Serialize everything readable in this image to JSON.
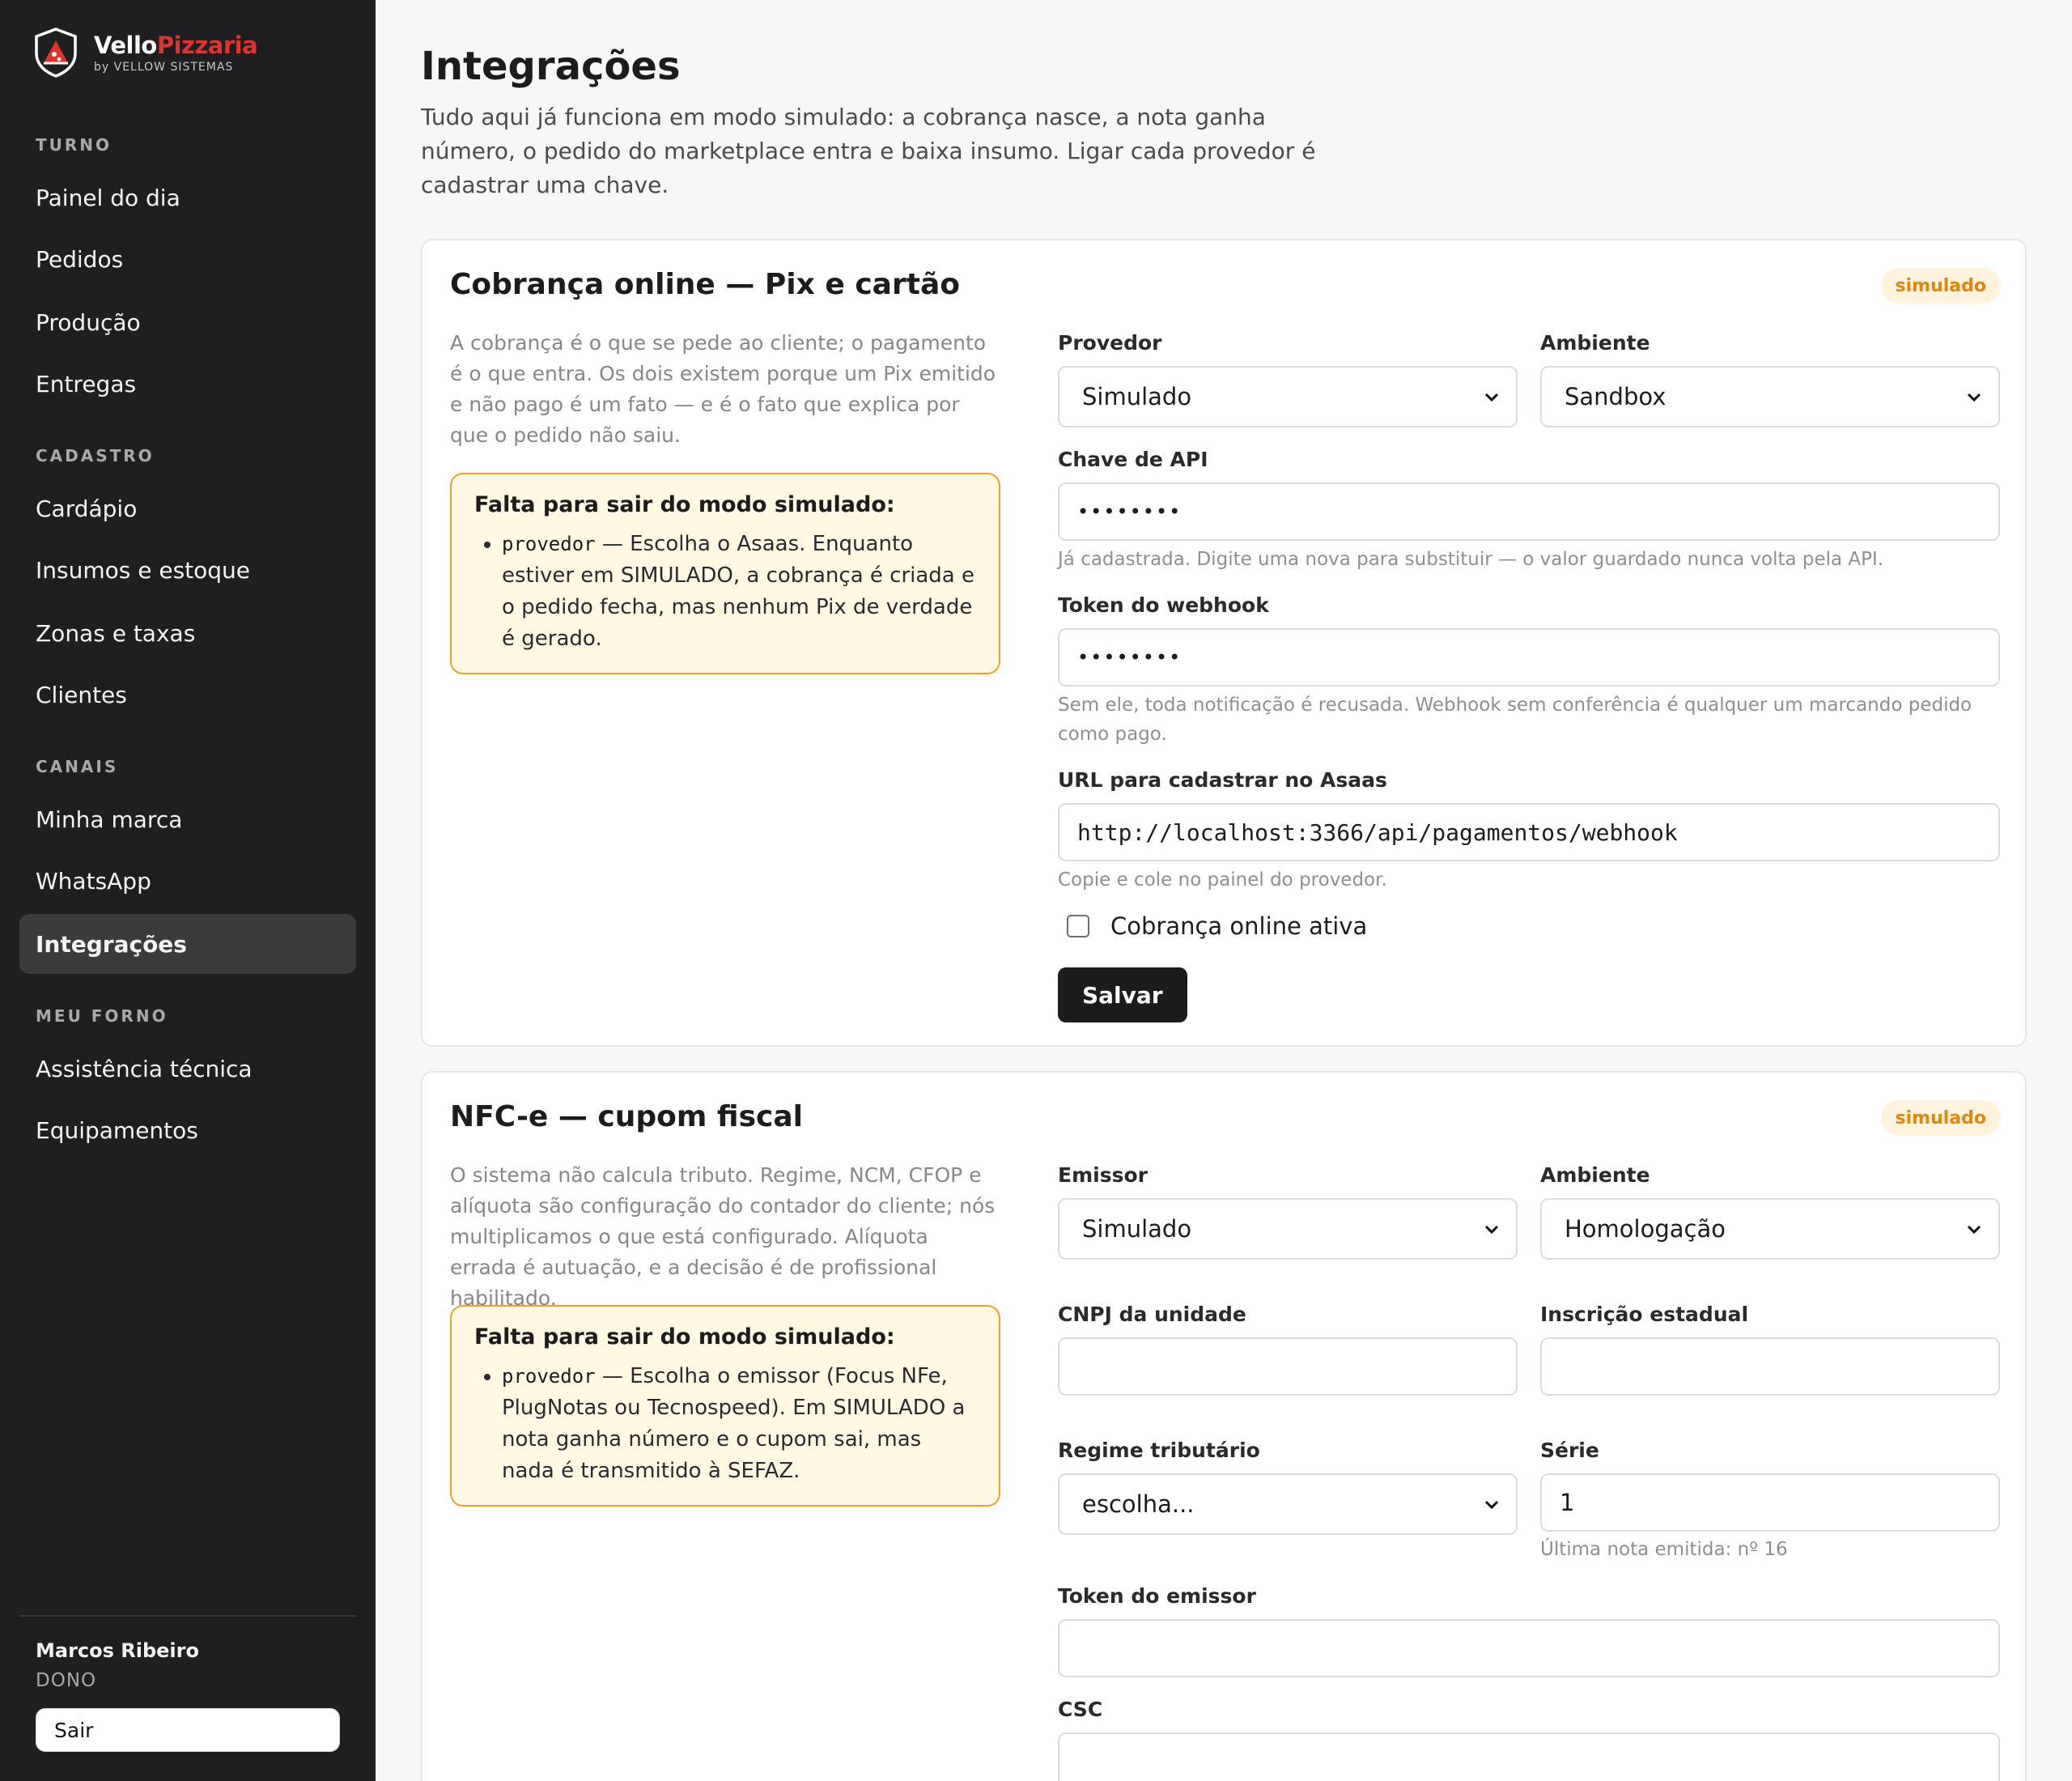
{
  "brand": {
    "name_part1": "Vello",
    "name_part2": "Pizzaria",
    "subtitle": "by VELLOW SISTEMAS",
    "accent_color": "#e2332b",
    "icon": "pizza-shield-icon"
  },
  "sidebar": {
    "sections": [
      {
        "label": "TURNO",
        "items": [
          "Painel do dia",
          "Pedidos",
          "Produção",
          "Entregas"
        ]
      },
      {
        "label": "CADASTRO",
        "items": [
          "Cardápio",
          "Insumos e estoque",
          "Zonas e taxas",
          "Clientes"
        ]
      },
      {
        "label": "CANAIS",
        "items": [
          "Minha marca",
          "WhatsApp",
          "Integrações"
        ]
      },
      {
        "label": "MEU FORNO",
        "items": [
          "Assistência técnica",
          "Equipamentos"
        ]
      }
    ],
    "active_item": "Integrações",
    "user": {
      "name": "Marcos Ribeiro",
      "role": "DONO"
    },
    "logout_label": "Sair"
  },
  "page": {
    "title": "Integrações",
    "description": "Tudo aqui já funciona em modo simulado: a cobrança nasce, a nota ganha número, o pedido do marketplace entra e baixa insumo. Ligar cada provedor é cadastrar uma chave."
  },
  "cards": {
    "payment": {
      "title": "Cobrança online — Pix e cartão",
      "badge": "simulado",
      "description": "A cobrança é o que se pede ao cliente; o pagamento é o que entra. Os dois existem porque um Pix emitido e não pago é um fato — e é o fato que explica por que o pedido não saiu.",
      "warning_title": "Falta para sair do modo simulado:",
      "warning_code": "provedor",
      "warning_text": " — Escolha o Asaas. Enquanto estiver em SIMULADO, a cobrança é criada e o pedido fecha, mas nenhum Pix de verdade é gerado.",
      "provider_label": "Provedor",
      "provider_value": "Simulado",
      "env_label": "Ambiente",
      "env_value": "Sandbox",
      "api_key_label": "Chave de API",
      "api_key_value": "••••••••",
      "api_key_hint": "Já cadastrada. Digite uma nova para substituir — o valor guardado nunca volta pela API.",
      "webhook_token_label": "Token do webhook",
      "webhook_token_value": "••••••••",
      "webhook_token_hint": "Sem ele, toda notificação é recusada. Webhook sem conferência é qualquer um marcando pedido como pago.",
      "url_label": "URL para cadastrar no Asaas",
      "url_value": "http://localhost:3366/api/pagamentos/webhook",
      "url_hint": "Copie e cole no painel do provedor.",
      "active_checkbox_label": "Cobrança online ativa",
      "active_checked": false,
      "save_label": "Salvar"
    },
    "nfce": {
      "title": "NFC-e — cupom fiscal",
      "badge": "simulado",
      "description": "O sistema não calcula tributo. Regime, NCM, CFOP e alíquota são configuração do contador do cliente; nós multiplicamos o que está configurado. Alíquota errada é autuação, e a decisão é de profissional habilitado.",
      "warning_title": "Falta para sair do modo simulado:",
      "warning_code": "provedor",
      "warning_text": " — Escolha o emissor (Focus NFe, PlugNotas ou Tecnospeed). Em SIMULADO a nota ganha número e o cupom sai, mas nada é transmitido à SEFAZ.",
      "emitter_label": "Emissor",
      "emitter_value": "Simulado",
      "env_label": "Ambiente",
      "env_value": "Homologação",
      "cnpj_label": "CNPJ da unidade",
      "cnpj_value": "",
      "ie_label": "Inscrição estadual",
      "ie_value": "",
      "regime_label": "Regime tributário",
      "regime_value": "escolha...",
      "serie_label": "Série",
      "serie_value": "1",
      "serie_hint": "Última nota emitida: nº 16",
      "token_label": "Token do emissor",
      "token_value": "",
      "csc_label": "CSC",
      "csc_value": ""
    }
  }
}
